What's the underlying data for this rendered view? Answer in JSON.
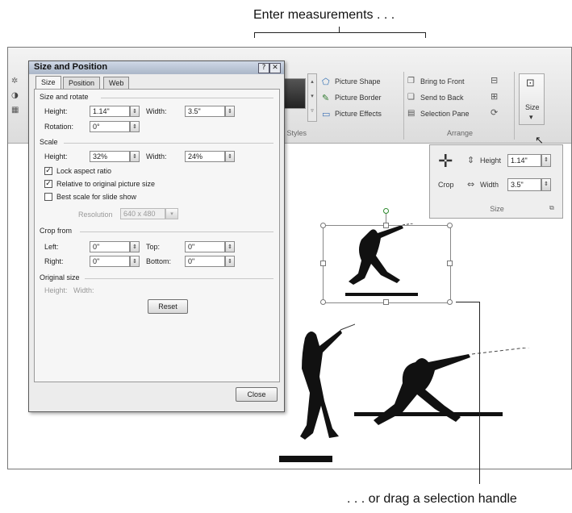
{
  "callouts": {
    "top": "Enter measurements . . .",
    "bottom": ". . . or drag a selection handle"
  },
  "ribbon": {
    "picture_styles": {
      "items": [
        "Picture Shape",
        "Picture Border",
        "Picture Effects"
      ],
      "group_label": "re Styles"
    },
    "arrange": {
      "items": [
        "Bring to Front",
        "Send to Back",
        "Selection Pane"
      ],
      "group_label": "Arrange"
    },
    "size_button_label": "Size"
  },
  "size_pane": {
    "crop_label": "Crop",
    "height_label": "Height",
    "height_value": "1.14\"",
    "width_label": "Width",
    "width_value": "3.5\"",
    "group_label": "Size"
  },
  "dialog": {
    "title": "Size and Position",
    "tabs": [
      "Size",
      "Position",
      "Web"
    ],
    "size_rotate": {
      "heading": "Size and rotate",
      "height_label": "Height:",
      "height_value": "1.14\"",
      "width_label": "Width:",
      "width_value": "3.5\"",
      "rotation_label": "Rotation:",
      "rotation_value": "0°"
    },
    "scale": {
      "heading": "Scale",
      "height_label": "Height:",
      "height_value": "32%",
      "width_label": "Width:",
      "width_value": "24%",
      "lock_aspect": {
        "label": "Lock aspect ratio",
        "checked": true
      },
      "relative_original": {
        "label": "Relative to original picture size",
        "checked": true
      },
      "best_scale": {
        "label": "Best scale for slide show",
        "checked": false
      },
      "resolution_label": "Resolution",
      "resolution_value": "640 x 480"
    },
    "crop": {
      "heading": "Crop from",
      "left_label": "Left:",
      "left_value": "0\"",
      "top_label": "Top:",
      "top_value": "0\"",
      "right_label": "Right:",
      "right_value": "0\"",
      "bottom_label": "Bottom:",
      "bottom_value": "0\""
    },
    "original": {
      "heading": "Original size",
      "height_label": "Height:",
      "width_label": "Width:"
    },
    "reset_label": "Reset",
    "close_label": "Close"
  }
}
